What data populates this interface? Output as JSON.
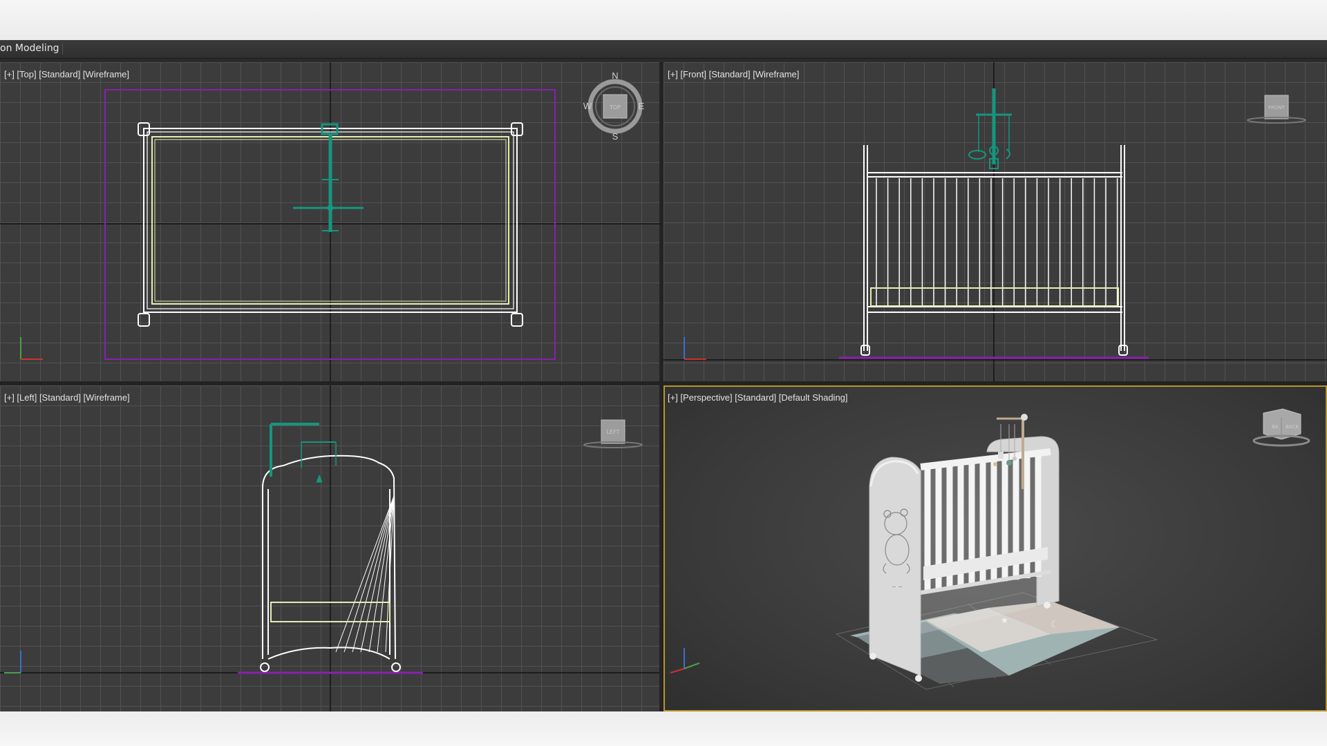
{
  "app": {
    "mode_tab": "on Modeling"
  },
  "viewports": [
    {
      "id": "top",
      "label": "[+] [Top] [Standard] [Wireframe]",
      "cube": "TOP",
      "compass": [
        "N",
        "S",
        "W",
        "E"
      ]
    },
    {
      "id": "front",
      "label": "[+] [Front] [Standard] [Wireframe]",
      "cube": "FRONT"
    },
    {
      "id": "left",
      "label": "[+] [Left] [Standard] [Wireframe]",
      "cube": "LEFT"
    },
    {
      "id": "perspective",
      "label": "[+] [Perspective] [Standard] [Default Shading]",
      "cube": "BACK",
      "active": true
    }
  ],
  "colors": {
    "wireframe": "#ffffff",
    "selection": "#16957f",
    "mattress": "#e6efb4",
    "bounding_box": "#8a1fb1",
    "active_border": "#b8952e",
    "grid": "#525252",
    "viewport_bg": "#3c3c3c"
  },
  "icons": [
    "viewcube-icon",
    "compass-icon",
    "axis-tripod-icon"
  ]
}
